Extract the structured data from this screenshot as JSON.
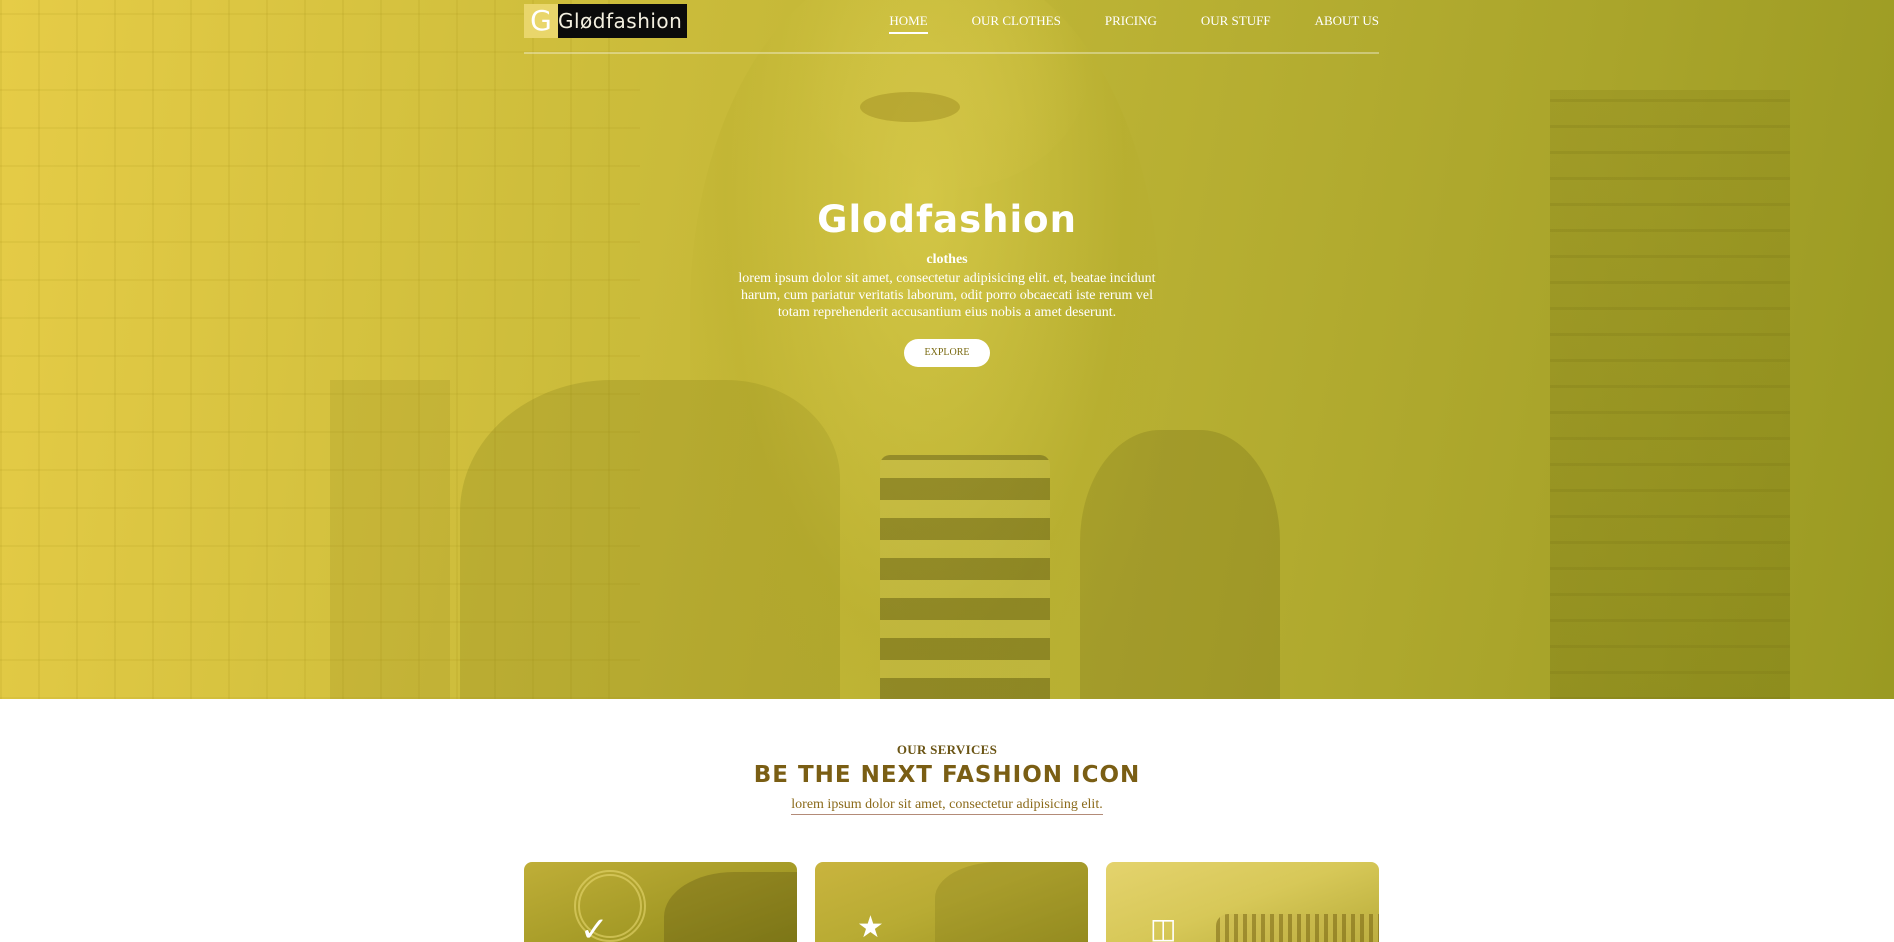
{
  "brand": {
    "logo_mark": "G",
    "logo_text": "Glødfashion"
  },
  "nav": {
    "items": [
      {
        "label": "HOME",
        "active": true
      },
      {
        "label": "OUR CLOTHES",
        "active": false
      },
      {
        "label": "PRICING",
        "active": false
      },
      {
        "label": "OUR STUFF",
        "active": false
      },
      {
        "label": "ABOUT US",
        "active": false
      }
    ]
  },
  "hero": {
    "title": "Glodfashion",
    "subtitle": "clothes",
    "description": "lorem ipsum dolor sit amet, consectetur adipisicing elit. et, beatae incidunt harum, cum pariatur veritatis laborum, odit porro obcaecati iste rerum vel totam reprehenderit accusantium eius nobis a amet deserunt.",
    "button_label": "EXPLORE"
  },
  "services": {
    "eyebrow": "OUR SERVICES",
    "title": "BE THE NEXT FASHION ICON",
    "description": "lorem ipsum dolor sit amet, consectetur adipisicing elit."
  },
  "cards": [
    {
      "icon": "checkmark-icon",
      "glyph": "✓"
    },
    {
      "icon": "star-icon",
      "glyph": "★"
    },
    {
      "icon": "shirt-icon",
      "glyph": "◫"
    }
  ],
  "colors": {
    "hero_overlay": "#cdbd3b",
    "accent_brown": "#7a5e14",
    "link_underline": "#b38b78"
  }
}
